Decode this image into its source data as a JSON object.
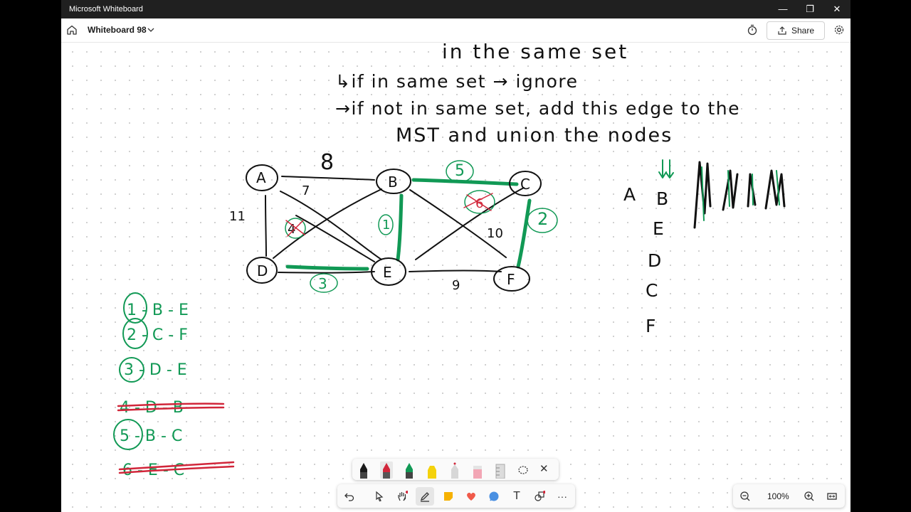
{
  "window": {
    "app_title": "Microsoft Whiteboard",
    "minimize_glyph": "—",
    "restore_glyph": "❐",
    "close_glyph": "✕"
  },
  "header": {
    "board_name": "Whiteboard 98",
    "share_label": "Share",
    "icons": [
      "home-icon",
      "chevron-down-icon",
      "timer-icon",
      "share-icon",
      "settings-icon"
    ]
  },
  "ink": {
    "text_lines": [
      "in  the  same  set",
      "↳if  in same  set  → ignore",
      "→if  not  in  same set,  add  this edge to the",
      "MST   and   union   the nodes"
    ],
    "nodes": [
      "A",
      "B",
      "C",
      "D",
      "E",
      "F"
    ],
    "edge_weights": [
      "8",
      "7",
      "11",
      "4",
      "1",
      "5",
      "6",
      "2",
      "10",
      "3",
      "9"
    ],
    "sorted_edges": [
      "1 - B - E",
      "2 - C - F",
      "3 - D - E",
      "4 - D - B",
      "5 - B - C",
      "6 - E - C"
    ],
    "union_list": [
      "A",
      "B",
      "E",
      "D",
      "C",
      "F"
    ],
    "colors": {
      "black_ink": "#111111",
      "green_ink": "#119955",
      "red_ink": "#d1263a"
    }
  },
  "pen_tray": {
    "pens": [
      "black-pen",
      "red-pen",
      "green-pen",
      "yellow-highlighter",
      "eraser-pen",
      "pink-highlighter",
      "ruler"
    ],
    "close_glyph": "✕",
    "colors": {
      "black": "#1b1b1b",
      "red": "#d1263a",
      "green": "#119955",
      "yellow": "#f4d20c",
      "pink": "#f2a6b5"
    }
  },
  "toolbar": {
    "tools": [
      "undo-icon",
      "select-icon",
      "hand-icon",
      "pen-icon",
      "sticky-note-icon",
      "reaction-icon",
      "comment-icon",
      "text-icon",
      "shapes-icon",
      "more-icon"
    ],
    "text_glyph": "T",
    "more_glyph": "···"
  },
  "zoom": {
    "level": "100%",
    "zoom_out_glyph": "−",
    "zoom_in_glyph": "+"
  }
}
